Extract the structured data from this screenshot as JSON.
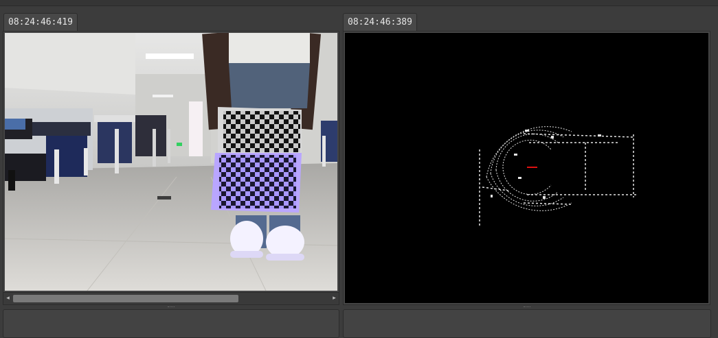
{
  "panels": [
    {
      "timestamp": "08:24:46:419",
      "content": "camera-image"
    },
    {
      "timestamp": "08:24:46:389",
      "content": "lidar-pointcloud"
    }
  ],
  "scrollbar": {
    "left_arrow": "◂",
    "right_arrow": "▸"
  },
  "colors": {
    "chessboard_glow": "#b09bff",
    "pointcloud": "#e6e6e6",
    "origin_marker": "#e01010"
  }
}
